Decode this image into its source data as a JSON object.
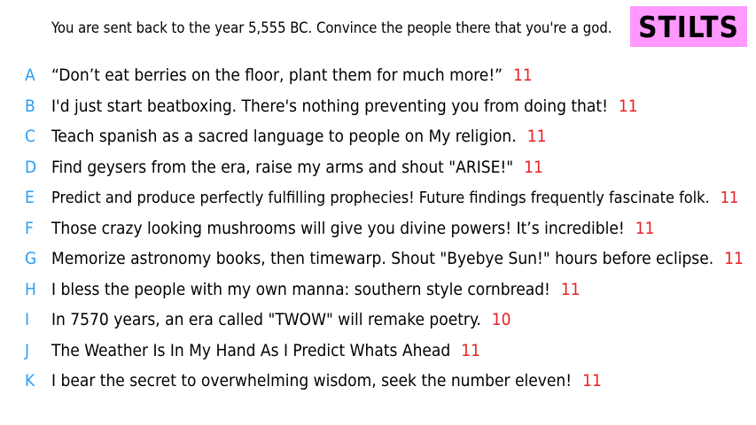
{
  "prompt": "You are sent back to the year 5,555 BC. Convince the people there that you're a god.",
  "badge": "STILTS",
  "colors": {
    "badge_bg": "#ff99ff",
    "letter": "#2a9df4",
    "score": "#e82020"
  },
  "responses": [
    {
      "letter": "A",
      "text": "“Don’t eat berries on the floor, plant them for much more!”",
      "score": "11"
    },
    {
      "letter": "B",
      "text": "I'd just start beatboxing. There's nothing preventing you from doing that!",
      "score": "11"
    },
    {
      "letter": "C",
      "text": "Teach spanish as a sacred language to people on My religion.",
      "score": "11"
    },
    {
      "letter": "D",
      "text": "Find geysers from the era, raise my arms and shout \"ARISE!\"",
      "score": "11"
    },
    {
      "letter": "E",
      "text": "Predict and produce perfectly fulfilling prophecies! Future findings frequently fascinate folk.",
      "score": "11"
    },
    {
      "letter": "F",
      "text": "Those crazy looking mushrooms will give you divine powers! It’s incredible!",
      "score": "11"
    },
    {
      "letter": "G",
      "text": "Memorize astronomy books, then timewarp. Shout \"Byebye Sun!\" hours before eclipse.",
      "score": "11"
    },
    {
      "letter": "H",
      "text": "I bless the people with my own manna: southern style cornbread!",
      "score": "11"
    },
    {
      "letter": "I",
      "text": "In 7570 years, an era called \"TWOW\" will remake poetry.",
      "score": "10"
    },
    {
      "letter": "J",
      "text": "The Weather Is In My Hand As I Predict Whats Ahead",
      "score": "11"
    },
    {
      "letter": "K",
      "text": "I bear the secret to overwhelming wisdom, seek the number eleven!",
      "score": "11"
    }
  ]
}
